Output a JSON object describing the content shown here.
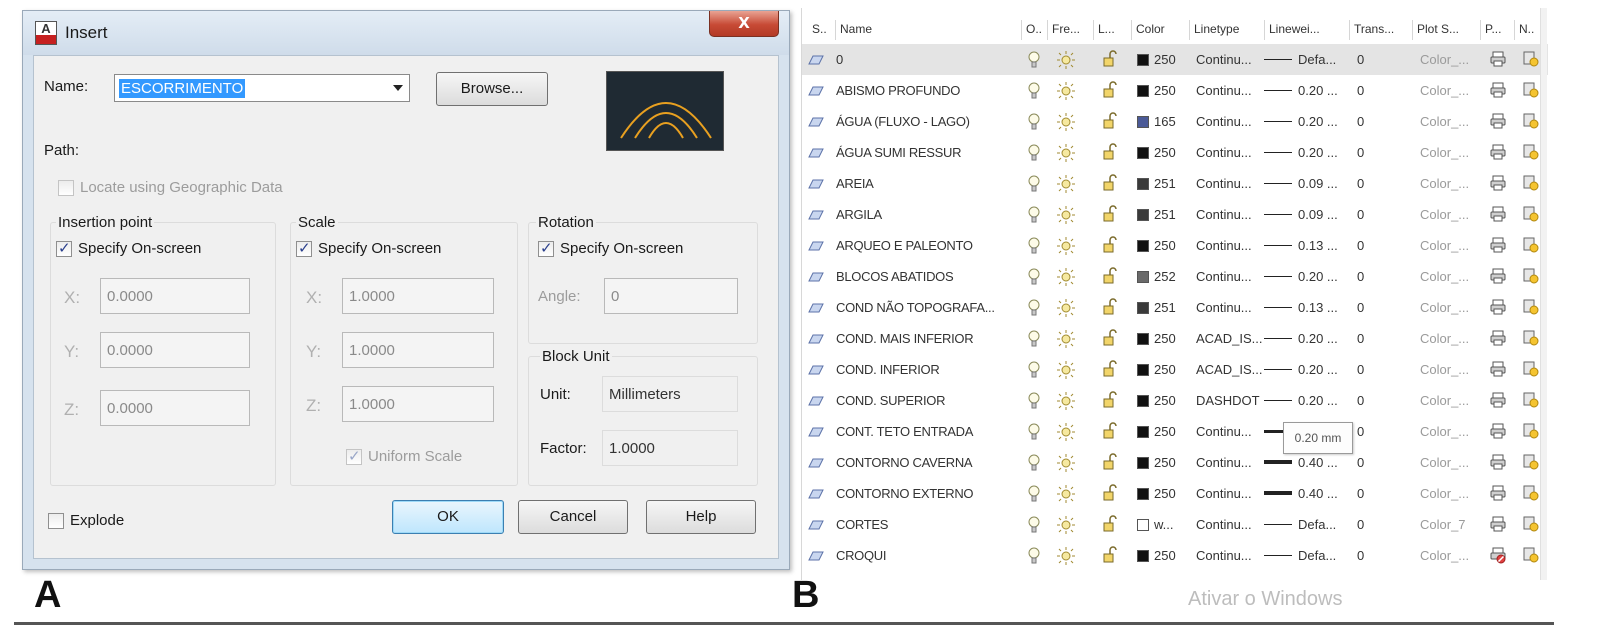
{
  "panel_labels": {
    "a": "A",
    "b": "B"
  },
  "insert_dialog": {
    "title": "Insert",
    "close_symbol": "X",
    "name_label": "Name:",
    "name_value": "ESCORRIMENTO",
    "browse_label": "Browse...",
    "path_label": "Path:",
    "geo_label": "Locate using Geographic Data",
    "insertion_point": {
      "title": "Insertion point",
      "specify_label": "Specify On-screen",
      "x_label": "X:",
      "x_value": "0.0000",
      "y_label": "Y:",
      "y_value": "0.0000",
      "z_label": "Z:",
      "z_value": "0.0000"
    },
    "scale": {
      "title": "Scale",
      "specify_label": "Specify On-screen",
      "x_label": "X:",
      "x_value": "1.0000",
      "y_label": "Y:",
      "y_value": "1.0000",
      "z_label": "Z:",
      "z_value": "1.0000",
      "uniform_label": "Uniform Scale"
    },
    "rotation": {
      "title": "Rotation",
      "specify_label": "Specify On-screen",
      "angle_label": "Angle:",
      "angle_value": "0"
    },
    "block_unit": {
      "title": "Block Unit",
      "unit_label": "Unit:",
      "unit_value": "Millimeters",
      "factor_label": "Factor:",
      "factor_value": "1.0000"
    },
    "explode_label": "Explode",
    "ok_label": "OK",
    "cancel_label": "Cancel",
    "help_label": "Help"
  },
  "layer_panel": {
    "headers": [
      "S..",
      "Name",
      "O..",
      "Fre...",
      "L...",
      "Color",
      "Linetype",
      "Linewei...",
      "Trans...",
      "Plot S...",
      "P...",
      "N.."
    ],
    "tooltip": "0.20 mm",
    "rows": [
      {
        "name": "0",
        "color": "250",
        "swatch": "#111111",
        "linetype": "Continu...",
        "lineweight": "Defa...",
        "trans": "0",
        "plot": "Color_...",
        "weight": "thin",
        "selected": true
      },
      {
        "name": "ABISMO PROFUNDO",
        "color": "250",
        "swatch": "#111111",
        "linetype": "Continu...",
        "lineweight": "0.20 ...",
        "trans": "0",
        "plot": "Color_...",
        "weight": "thin"
      },
      {
        "name": "ÁGUA (FLUXO - LAGO)",
        "color": "165",
        "swatch": "#4b5a97",
        "linetype": "Continu...",
        "lineweight": "0.20 ...",
        "trans": "0",
        "plot": "Color_...",
        "weight": "thin"
      },
      {
        "name": "ÁGUA SUMI RESSUR",
        "color": "250",
        "swatch": "#111111",
        "linetype": "Continu...",
        "lineweight": "0.20 ...",
        "trans": "0",
        "plot": "Color_...",
        "weight": "thin"
      },
      {
        "name": "AREIA",
        "color": "251",
        "swatch": "#3a3a3a",
        "linetype": "Continu...",
        "lineweight": "0.09 ...",
        "trans": "0",
        "plot": "Color_...",
        "weight": "thin"
      },
      {
        "name": "ARGILA",
        "color": "251",
        "swatch": "#3a3a3a",
        "linetype": "Continu...",
        "lineweight": "0.09 ...",
        "trans": "0",
        "plot": "Color_...",
        "weight": "thin"
      },
      {
        "name": "ARQUEO E PALEONTO",
        "color": "250",
        "swatch": "#111111",
        "linetype": "Continu...",
        "lineweight": "0.13 ...",
        "trans": "0",
        "plot": "Color_...",
        "weight": "thin"
      },
      {
        "name": "BLOCOS ABATIDOS",
        "color": "252",
        "swatch": "#6a6a6a",
        "linetype": "Continu...",
        "lineweight": "0.20 ...",
        "trans": "0",
        "plot": "Color_...",
        "weight": "thin"
      },
      {
        "name": "COND NÃO TOPOGRAFA...",
        "color": "251",
        "swatch": "#3a3a3a",
        "linetype": "Continu...",
        "lineweight": "0.13 ...",
        "trans": "0",
        "plot": "Color_...",
        "weight": "thin"
      },
      {
        "name": "COND. MAIS INFERIOR",
        "color": "250",
        "swatch": "#111111",
        "linetype": "ACAD_IS...",
        "lineweight": "0.20 ...",
        "trans": "0",
        "plot": "Color_...",
        "weight": "thin"
      },
      {
        "name": "COND. INFERIOR",
        "color": "250",
        "swatch": "#111111",
        "linetype": "ACAD_IS...",
        "lineweight": "0.20 ...",
        "trans": "0",
        "plot": "Color_...",
        "weight": "thin"
      },
      {
        "name": "COND. SUPERIOR",
        "color": "250",
        "swatch": "#111111",
        "linetype": "DASHDOT",
        "lineweight": "0.20 ...",
        "trans": "0",
        "plot": "Color_...",
        "weight": "thin"
      },
      {
        "name": "CONT. TETO ENTRADA",
        "color": "250",
        "swatch": "#111111",
        "linetype": "Continu...",
        "lineweight": "",
        "trans": "0",
        "plot": "Color_...",
        "weight": "medium"
      },
      {
        "name": "CONTORNO CAVERNA",
        "color": "250",
        "swatch": "#111111",
        "linetype": "Continu...",
        "lineweight": "0.40 ...",
        "trans": "0",
        "plot": "Color_...",
        "weight": "bold"
      },
      {
        "name": "CONTORNO EXTERNO",
        "color": "250",
        "swatch": "#111111",
        "linetype": "Continu...",
        "lineweight": "0.40 ...",
        "trans": "0",
        "plot": "Color_...",
        "weight": "bold"
      },
      {
        "name": "CORTES",
        "color": "w...",
        "swatch": "#ffffff",
        "linetype": "Continu...",
        "lineweight": "Defa...",
        "trans": "0",
        "plot": "Color_7",
        "weight": "thin"
      },
      {
        "name": "CROQUI",
        "color": "250",
        "swatch": "#111111",
        "linetype": "Continu...",
        "lineweight": "Defa...",
        "trans": "0",
        "plot": "Color_...",
        "weight": "thin",
        "noplot": true
      }
    ]
  },
  "watermark": "Ativar o Windows"
}
